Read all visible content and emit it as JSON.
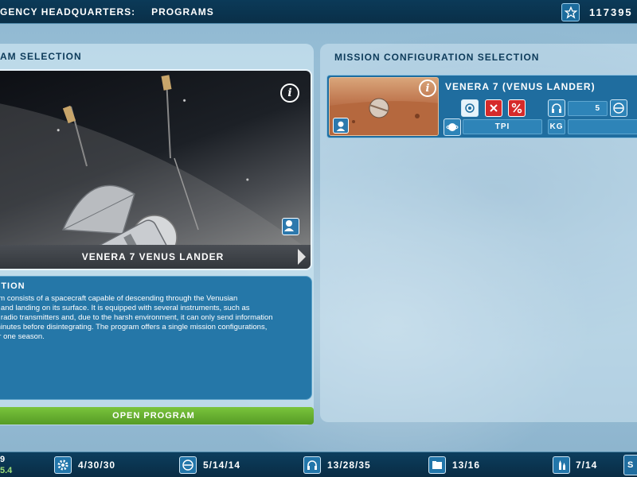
{
  "header": {
    "section": "gency Headquarters:",
    "page": "Programs",
    "funds": "117395"
  },
  "left_panel": {
    "title": "am Selection",
    "program_caption": "Venera 7 Venus Lander",
    "description_title": "ption",
    "description_text": "am consists of a spacecraft capable of descending through the Venusian\ne and landing on its surface. It is equipped with several instruments, such as\nd radio transmitters and, due to the harsh environment, it can only send information\nminutes before disintegrating. The program offers a single mission configurations,\nor one season.",
    "open_button": "Open Program"
  },
  "right_panel": {
    "title": "Mission Configuration Selection",
    "mission": {
      "name": "Venera 7 (Venus lander)",
      "count": "5",
      "field_tpi": "TPI",
      "field_kg": "KG"
    }
  },
  "bottom_bar": {
    "date_top": "9",
    "date_bottom": "5.4",
    "stats": [
      {
        "icon": "gear-icon",
        "value": "4/30/30"
      },
      {
        "icon": "capsule-icon",
        "value": "5/14/14"
      },
      {
        "icon": "headset-icon",
        "value": "13/28/35"
      },
      {
        "icon": "folder-icon",
        "value": "13/16"
      },
      {
        "icon": "rockets-icon",
        "value": "7/14"
      }
    ],
    "corner_label": "S"
  },
  "colors": {
    "header_bg": "#0b3a58",
    "accent_blue": "#2577a8",
    "open_button_green": "#6bb733",
    "delete_red": "#d62a2a"
  }
}
